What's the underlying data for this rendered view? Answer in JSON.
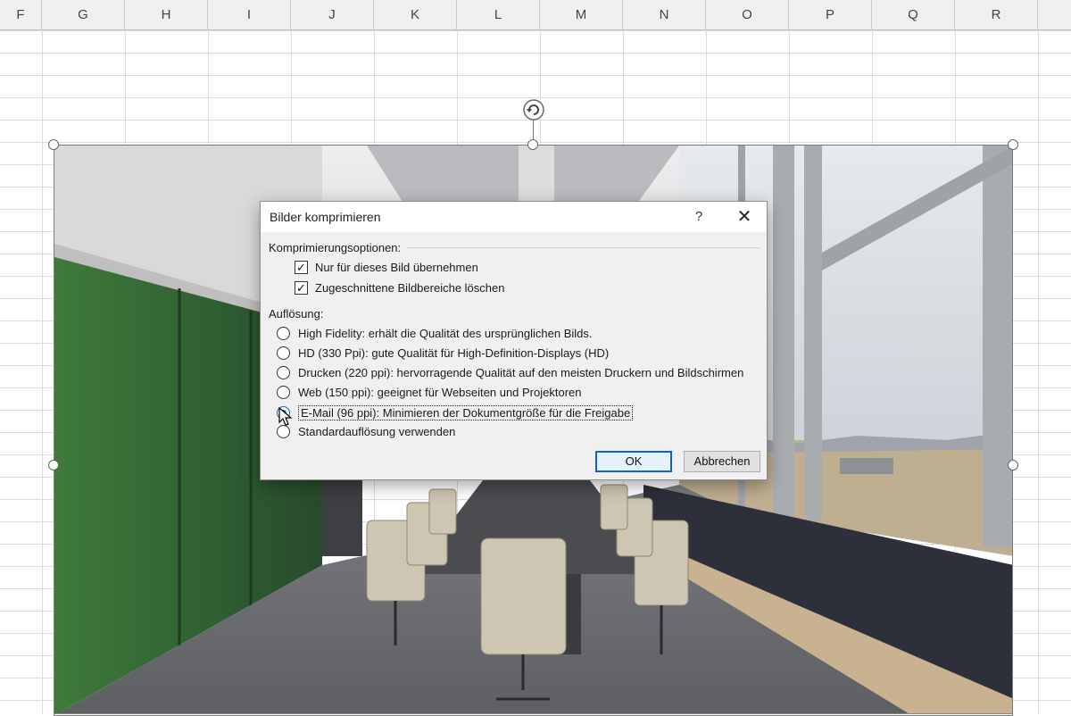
{
  "columns": [
    "F",
    "G",
    "H",
    "I",
    "J",
    "K",
    "L",
    "M",
    "N",
    "O",
    "P",
    "Q",
    "R"
  ],
  "dialog": {
    "title": "Bilder komprimieren",
    "help_label": "?",
    "close_label": "✕",
    "compression_group": {
      "label": "Komprimierungsoptionen:",
      "options": [
        {
          "label": "Nur für dieses Bild übernehmen",
          "checked": true
        },
        {
          "label": "Zugeschnittene Bildbereiche löschen",
          "checked": true
        }
      ]
    },
    "resolution_group": {
      "label": "Auflösung:",
      "options": [
        {
          "label": "High Fidelity: erhält die Qualität des ursprünglichen Bilds.",
          "selected": false
        },
        {
          "label": "HD (330 Ppi): gute Qualität für High-Definition-Displays (HD)",
          "selected": false
        },
        {
          "label": "Drucken (220 ppi): hervorragende Qualität auf den meisten Druckern und Bildschirmen",
          "selected": false
        },
        {
          "label": "Web (150 ppi): geeignet für Webseiten und Projektoren",
          "selected": false
        },
        {
          "label": "E-Mail (96 ppi): Minimieren der Dokumentgröße für die Freigabe",
          "selected": true
        },
        {
          "label": "Standardauflösung verwenden",
          "selected": false
        }
      ]
    },
    "ok_label": "OK",
    "cancel_label": "Abbrechen"
  },
  "colors": {
    "accent": "#0a64c8",
    "dialog_bg": "#f0f0f0",
    "header_bg": "#efefef"
  }
}
